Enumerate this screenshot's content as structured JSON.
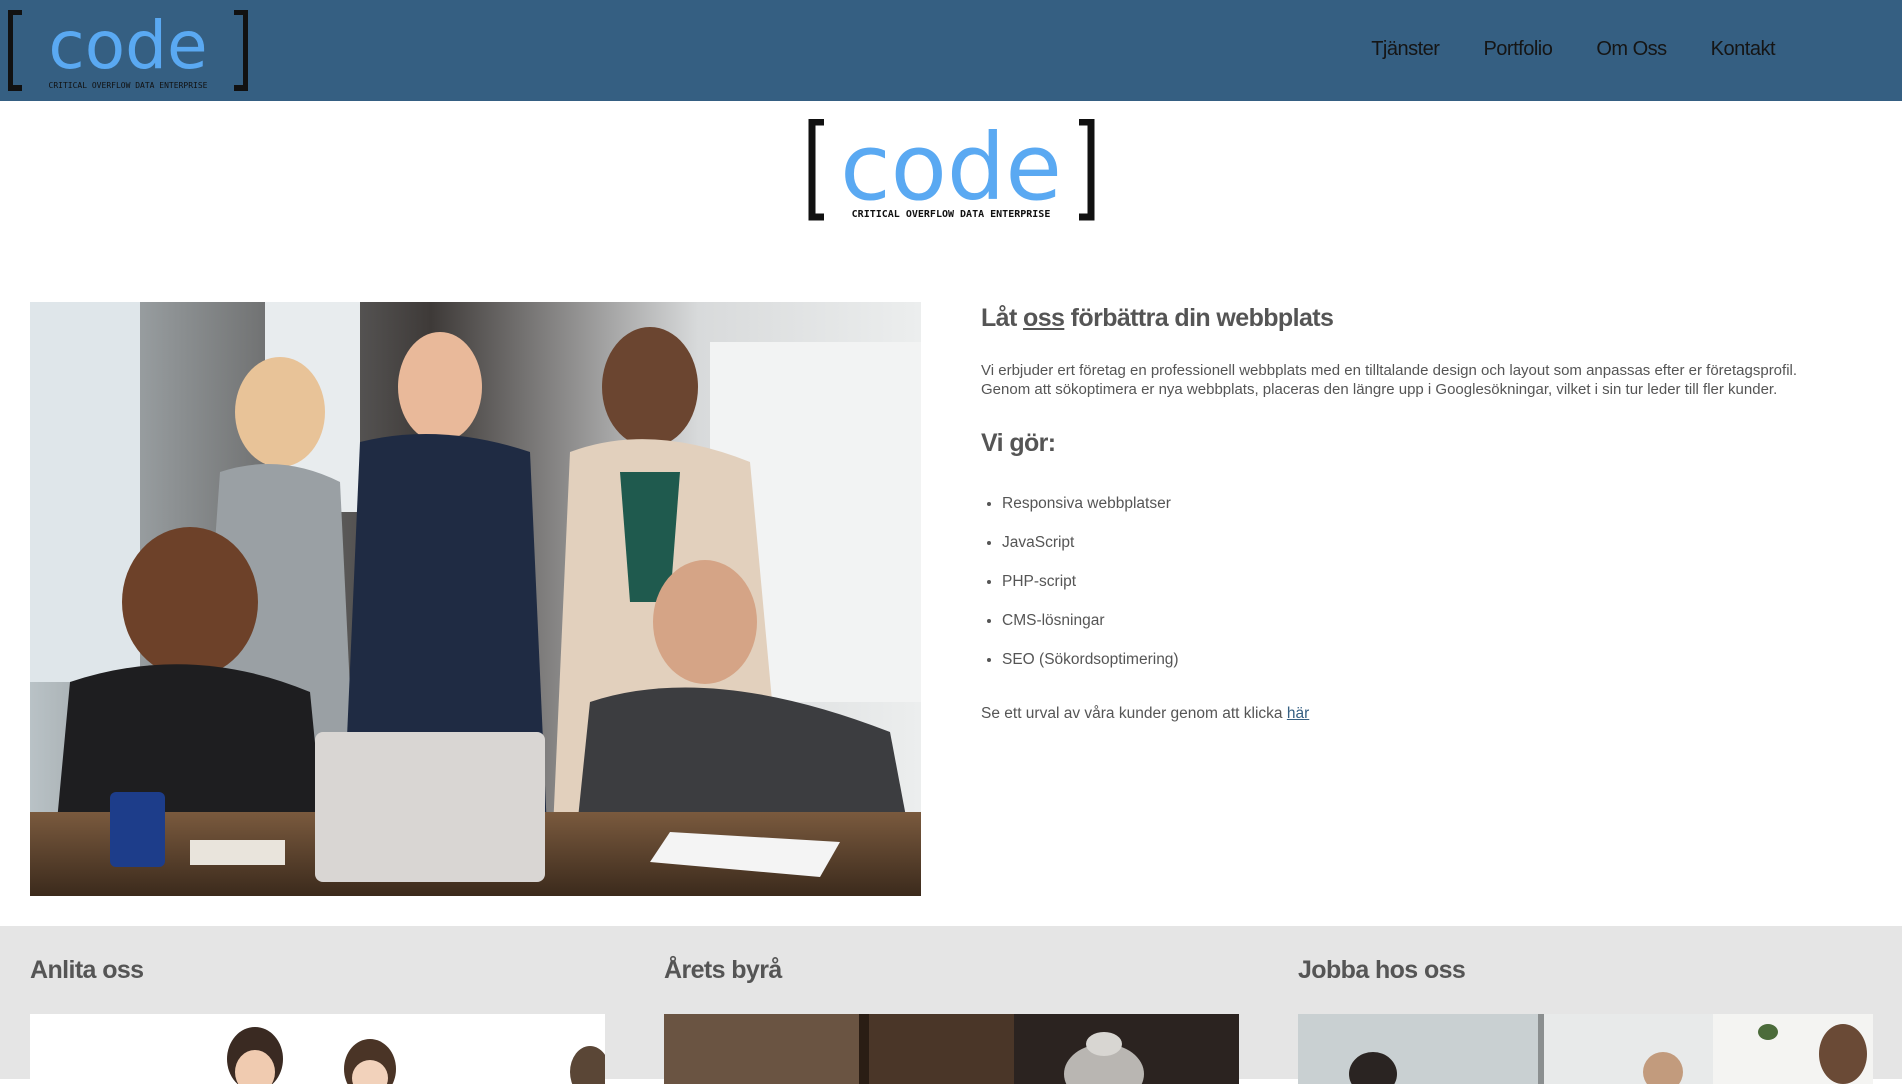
{
  "logo": {
    "text": "code",
    "tagline": "CRITICAL OVERFLOW DATA ENTERPRISE",
    "bracket_color": "#111111",
    "text_color": "#5aa9f2"
  },
  "nav": {
    "items": [
      "Tjänster",
      "Portfolio",
      "Om Oss",
      "Kontakt"
    ]
  },
  "hero": {
    "title_pre": "Låt ",
    "title_underlined": "oss",
    "title_post": " förbättra din webbplats",
    "lead_line1": "Vi erbjuder ert företag en professionell webbplats med en tilltalande design och layout som anpassas efter er företagsprofil.",
    "lead_line2": "Genom att sökoptimera er nya webbplats, placeras den längre upp i Googlesökningar, vilket i sin tur leder till fler kunder.",
    "services_title": "Vi gör:",
    "services": [
      "Responsiva webbplatser",
      "JavaScript",
      "PHP-script",
      "CMS-lösningar",
      "SEO (Sökordsoptimering)"
    ],
    "more_text": "Se ett urval av våra kunder genom att klicka ",
    "more_link": "här"
  },
  "columns": [
    {
      "title": "Anlita oss"
    },
    {
      "title": "Årets byrå"
    },
    {
      "title": "Jobba hos oss"
    }
  ],
  "colors": {
    "header_bg": "#355f82",
    "bottom_bg": "#e5e5e5",
    "text": "#555555"
  }
}
